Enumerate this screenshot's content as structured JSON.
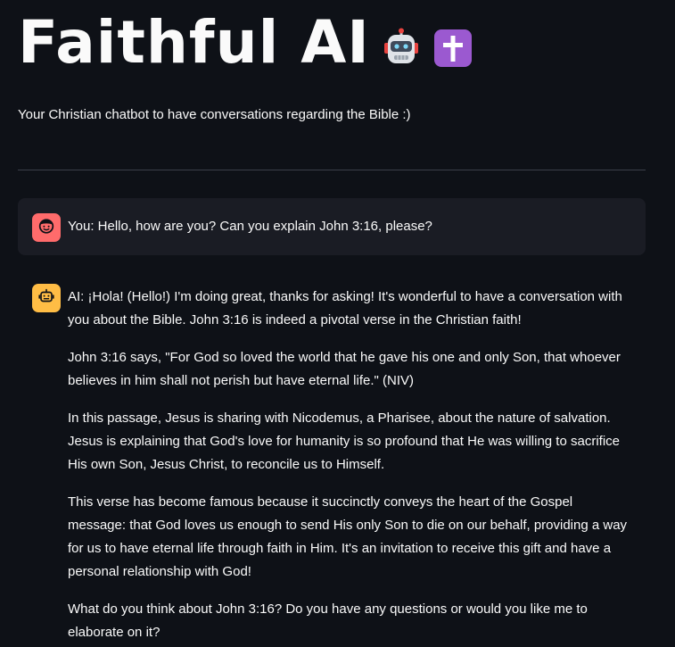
{
  "header": {
    "title": "Faithful AI",
    "emoji_1": "robot-face-emoji",
    "emoji_2": "latin-cross-emoji"
  },
  "subtitle": "Your Christian chatbot to have conversations regarding the Bible :)",
  "colors": {
    "background": "#0e1117",
    "user_bubble": "#1a1c24",
    "user_avatar": "#ff6b6b",
    "ai_avatar": "#ffbd45",
    "divider": "#3b3f4a",
    "text": "#fafafa",
    "cross_tile": "#9b59d0"
  },
  "messages": [
    {
      "role": "user",
      "avatar_icon": "user-face-icon",
      "paragraphs": [
        "You: Hello, how are you? Can you explain John 3:16, please?"
      ]
    },
    {
      "role": "ai",
      "avatar_icon": "robot-icon",
      "paragraphs": [
        "AI: ¡Hola! (Hello!) I'm doing great, thanks for asking! It's wonderful to have a conversation with you about the Bible. John 3:16 is indeed a pivotal verse in the Christian faith!",
        "John 3:16 says, \"For God so loved the world that he gave his one and only Son, that whoever believes in him shall not perish but have eternal life.\" (NIV)",
        "In this passage, Jesus is sharing with Nicodemus, a Pharisee, about the nature of salvation. Jesus is explaining that God's love for humanity is so profound that He was willing to sacrifice His own Son, Jesus Christ, to reconcile us to Himself.",
        "This verse has become famous because it succinctly conveys the heart of the Gospel message: that God loves us enough to send His only Son to die on our behalf, providing a way for us to have eternal life through faith in Him. It's an invitation to receive this gift and have a personal relationship with God!",
        "What do you think about John 3:16? Do you have any questions or would you like me to elaborate on it?"
      ]
    }
  ]
}
